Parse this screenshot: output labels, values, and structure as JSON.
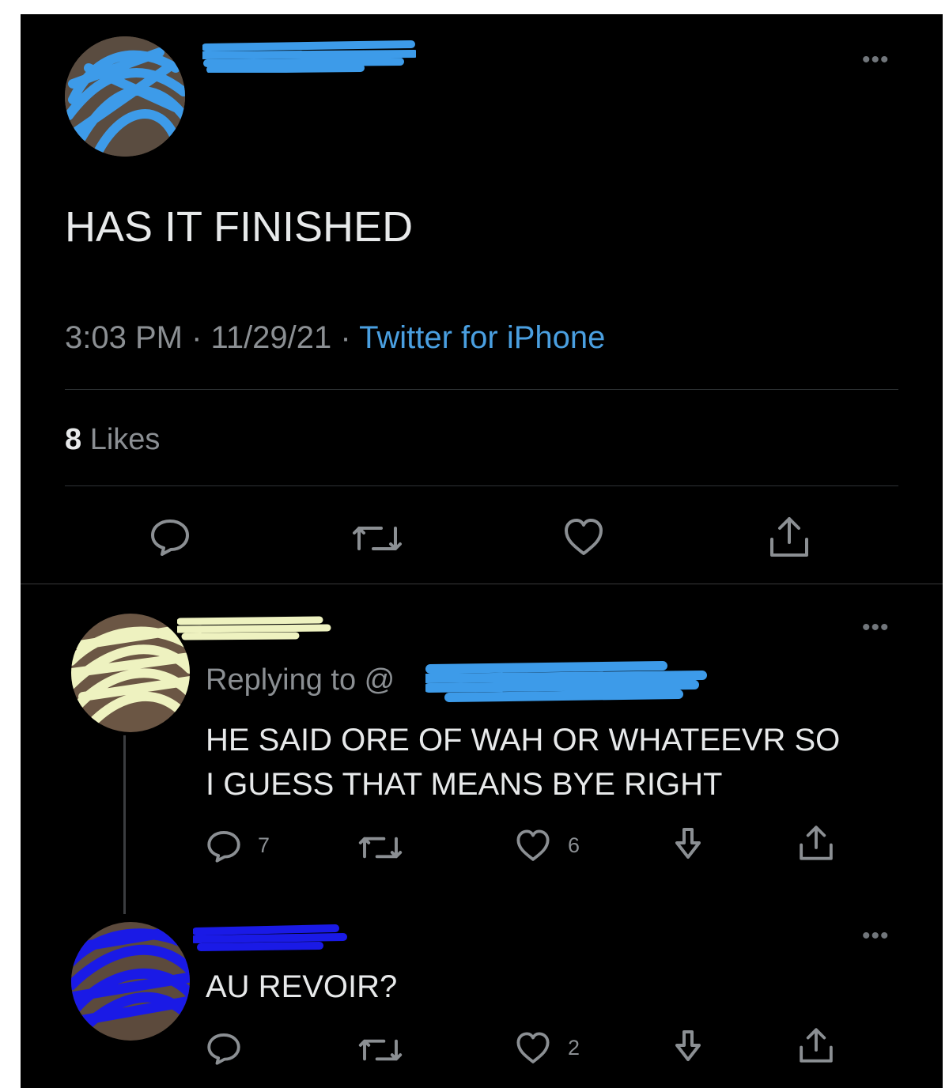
{
  "main_tweet": {
    "text": "HAS IT FINISHED",
    "time": "3:03 PM",
    "date": "11/29/21",
    "sep": "·",
    "source": "Twitter for iPhone",
    "likes_count": "8",
    "likes_label": "Likes",
    "more": "•••"
  },
  "reply_1": {
    "replying_to": "Replying to @",
    "text_line1": "HE SAID ORE OF WAH OR WHATEEVR SO",
    "text_line2": "I GUESS THAT MEANS BYE RIGHT",
    "reply_count": "7",
    "like_count": "6",
    "more": "•••"
  },
  "reply_2": {
    "text": "AU REVOIR?",
    "like_count": "2",
    "more": "•••"
  },
  "colors": {
    "background": "#000000",
    "text": "#e7e9ea",
    "muted": "#8b8f93",
    "link": "#4a9fe0",
    "scribble_blue_light": "#3d9be9",
    "scribble_yellow": "#eef2c0",
    "scribble_blue_dark": "#1a1ae6"
  },
  "icons": [
    "comment-icon",
    "retweet-icon",
    "heart-icon",
    "share-icon",
    "download-icon",
    "more-icon"
  ]
}
